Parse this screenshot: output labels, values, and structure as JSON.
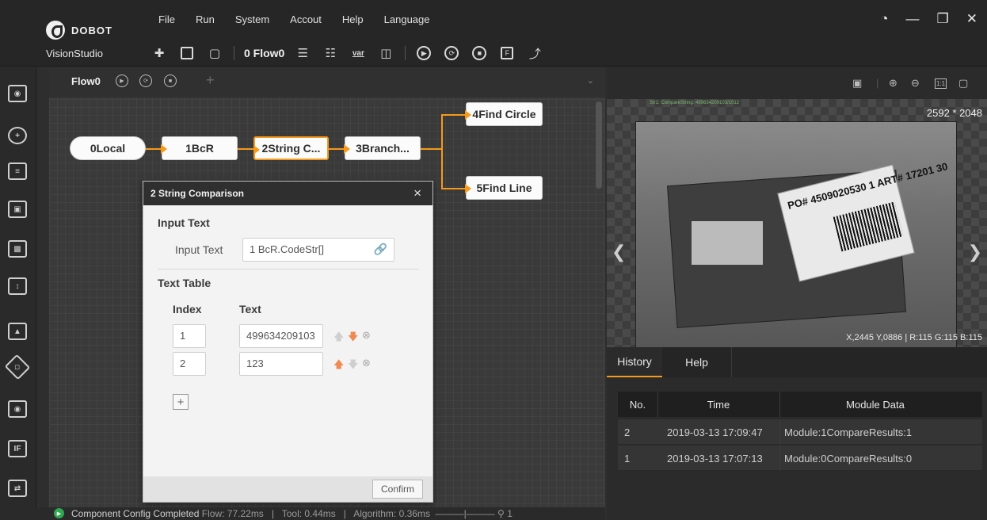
{
  "app": {
    "brand": "DOBOT",
    "product": "VisionStudio",
    "menu": [
      "File",
      "Run",
      "System",
      "Accout",
      "Help",
      "Language"
    ],
    "window_controls": [
      "speed-icon",
      "minimize-icon",
      "restore-icon",
      "close-icon"
    ]
  },
  "toolbar": {
    "flow_selector": "0 Flow0",
    "icons": [
      "add-module-icon",
      "save-icon",
      "open-folder-icon",
      "layers-icon",
      "hierarchy-icon",
      "variable-icon",
      "camera-icon",
      "run-once-icon",
      "run-loop-icon",
      "stop-icon",
      "f-icon",
      "robot-arm-icon"
    ],
    "variable_label": "var"
  },
  "flow_tab": {
    "name": "Flow0",
    "icons": [
      "run-once-icon",
      "run-loop-icon",
      "stop-icon"
    ],
    "add_label": "+"
  },
  "nodes": {
    "n0": "0Local",
    "n1": "1BcR",
    "n2": "2String C...",
    "n3": "3Branch...",
    "n4": "4Find Circle",
    "n5": "5Find Line"
  },
  "dialog": {
    "title": "2 String Comparison",
    "close": "×",
    "input_section": "Input Text",
    "input_label": "Input Text",
    "input_value": "1 BcR.CodeStr[]",
    "table_section": "Text Table",
    "col_index": "Index",
    "col_text": "Text",
    "rows": [
      {
        "index": "1",
        "text": "499634209103"
      },
      {
        "index": "2",
        "text": "123"
      }
    ],
    "add_label": "+",
    "confirm": "Confirm"
  },
  "status": {
    "message": "Component Config Completed",
    "flow": "Flow: 77.22ms",
    "tool": "Tool: 0.44ms",
    "algorithm": "Algorithm: 0.36ms",
    "zoom_value": "1"
  },
  "image": {
    "resolution": "2592 * 2048",
    "coords": "X,2445  Y,0886  |  R:115  G:115  B:115",
    "top_caption": "Str1: CompareString: 499634209103/1012",
    "label_text": "PO# 4509020530 1  ART# 17201 30",
    "toolbar_icons": [
      "fit-icon",
      "zoom-in-icon",
      "zoom-out-icon",
      "actual-size-icon",
      "fullscreen-icon"
    ],
    "actual_size_label": "1:1"
  },
  "history": {
    "tabs": [
      "History",
      "Help"
    ],
    "columns": [
      "No.",
      "Time",
      "Module Data"
    ],
    "rows": [
      {
        "no": "2",
        "time": "2019-03-13 17:09:47",
        "data": "Module:1CompareResults:1"
      },
      {
        "no": "1",
        "time": "2019-03-13 17:07:13",
        "data": "Module:0CompareResults:0"
      }
    ]
  },
  "colors": {
    "accent": "#f59a1b",
    "ok_green": "#2fa84f"
  }
}
